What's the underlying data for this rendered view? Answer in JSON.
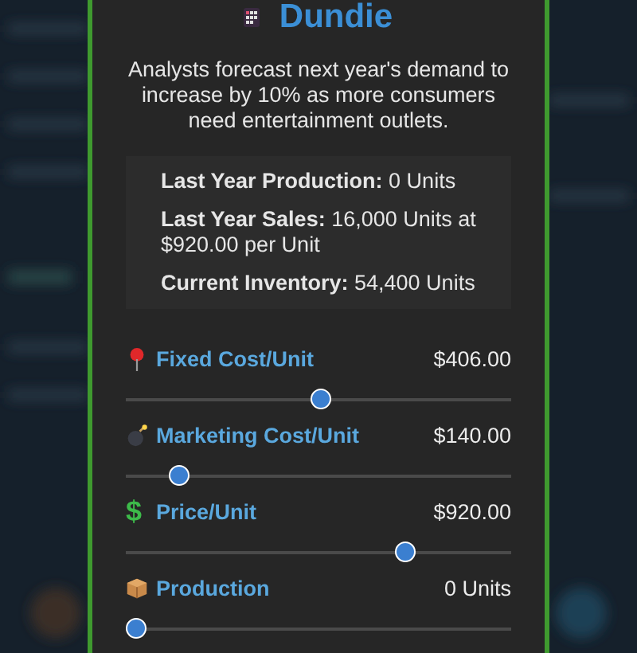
{
  "dialog": {
    "title": "Dundie",
    "description": "Analysts forecast next year's demand to increase by 10% as more consumers need entertainment outlets."
  },
  "stats": [
    {
      "label": "Last Year Production:",
      "value": "0 Units"
    },
    {
      "label": "Last Year Sales:",
      "value": "16,000 Units at $920.00 per Unit"
    },
    {
      "label": "Current Inventory:",
      "value": "54,400 Units"
    }
  ],
  "sliders": [
    {
      "kind": "pin",
      "label": "Fixed Cost/Unit",
      "reading": "$406.00",
      "level": 0.51
    },
    {
      "kind": "bomb",
      "label": "Marketing Cost/Unit",
      "reading": "$140.00",
      "level": 0.12
    },
    {
      "kind": "dollar",
      "symbol": "$",
      "label": "Price/Unit",
      "reading": "$920.00",
      "level": 0.74
    },
    {
      "kind": "box",
      "label": "Production",
      "reading": "0 Units",
      "level": 0
    }
  ]
}
